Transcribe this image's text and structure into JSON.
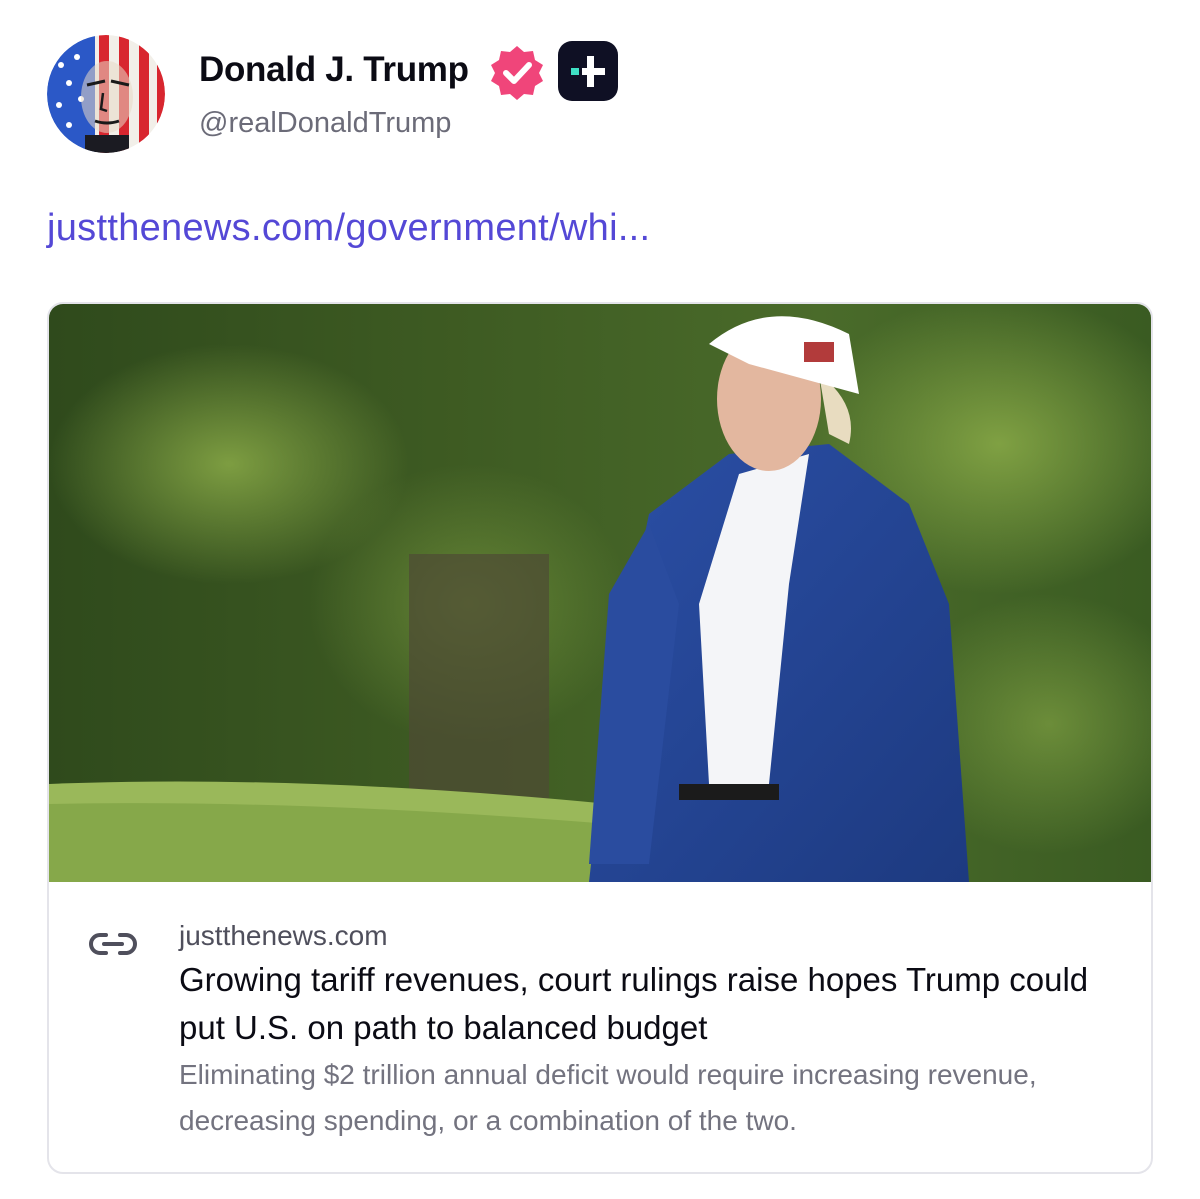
{
  "author": {
    "name": "Donald J. Trump",
    "handle": "@realDonaldTrump",
    "avatar_icon": "avatar-flag-portrait",
    "verified_icon": "verified-badge-icon",
    "verified_color": "#f0457a",
    "plus_icon": "plus-badge-icon"
  },
  "post": {
    "link_text": "justthenews.com/government/whi...",
    "link_color": "#5448d6"
  },
  "link_card": {
    "image_alt": "Photo of Trump in blue suit and white cap outdoors",
    "link_icon": "link-chain-icon",
    "domain": "justthenews.com",
    "title": "Growing tariff revenues, court rulings raise hopes Trump could put U.S. on path to balanced budget",
    "description": "Eliminating $2 trillion annual deficit would require increasing revenue, decreasing spending, or a combination of the two."
  }
}
